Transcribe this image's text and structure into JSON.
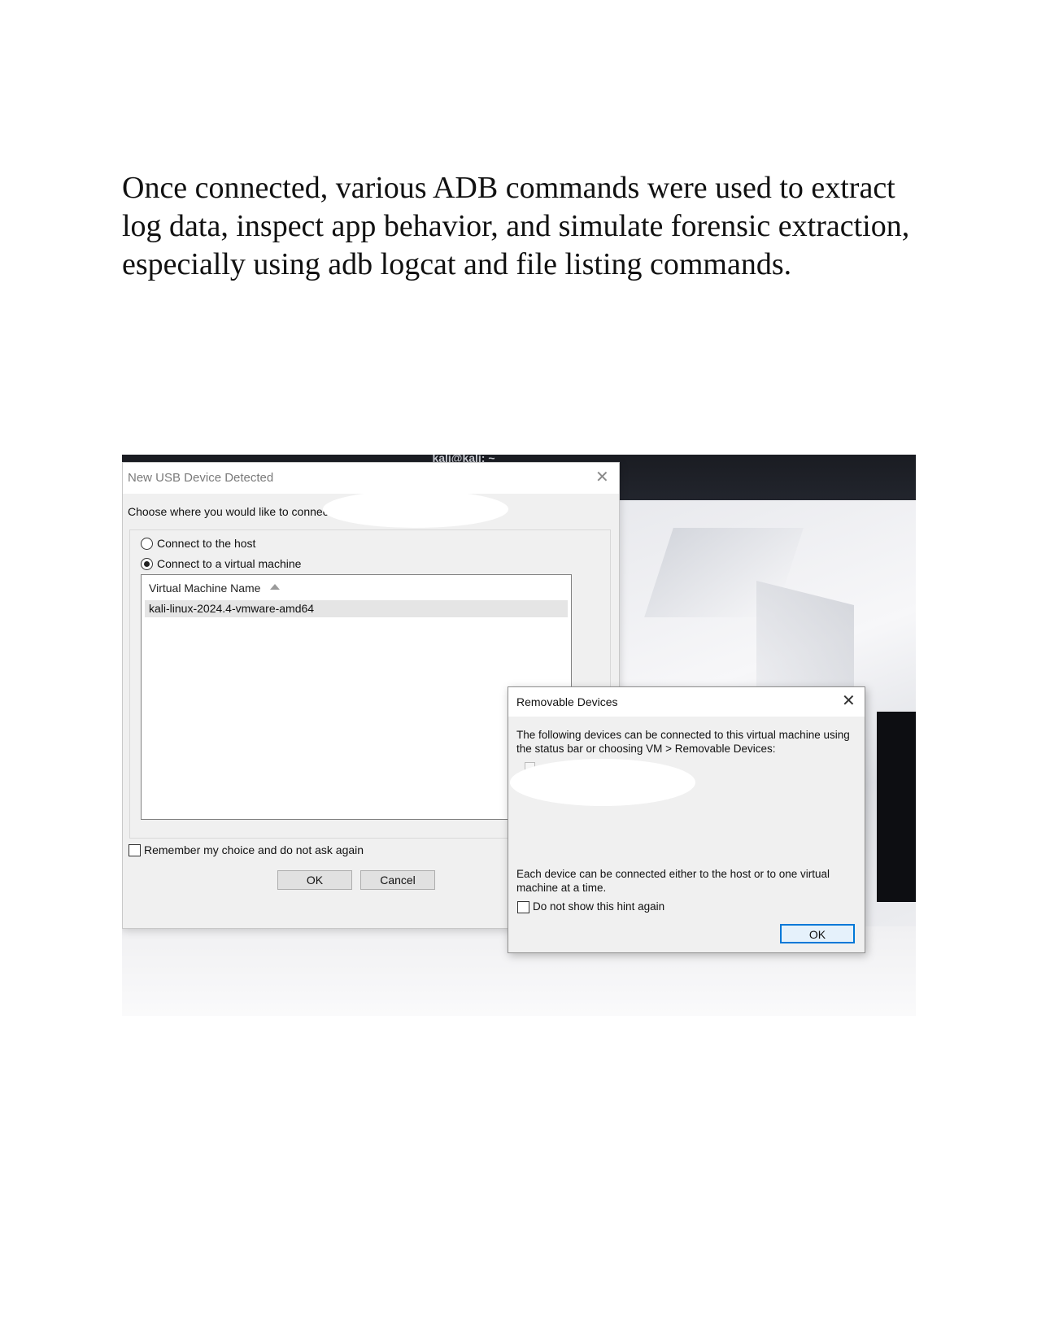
{
  "paragraph": "Once connected, various ADB commands were used to extract log data, inspect app behavior, and simulate forensic extraction, especially using adb logcat and file listing commands.",
  "terminal": {
    "title": "kali@kali: ~"
  },
  "usb_dialog": {
    "title": "New USB Device Detected",
    "prompt": "Choose where you would like to connect",
    "option_host": "Connect to the host",
    "option_vm": "Connect to a virtual machine",
    "selected_option": "Connect to a virtual machine",
    "column_header": "Virtual Machine Name",
    "vm_list": [
      "kali-linux-2024.4-vmware-amd64"
    ],
    "remember_label": "Remember my choice and do not ask again",
    "ok_label": "OK",
    "cancel_label": "Cancel"
  },
  "removable_dialog": {
    "title": "Removable Devices",
    "info": "The following devices can be connected to this virtual machine using the status bar or choosing VM > Removable Devices:",
    "note": "Each device can be connected either to the host or to one virtual machine at a time.",
    "hint_label": "Do not show this hint again",
    "ok_label": "OK"
  }
}
